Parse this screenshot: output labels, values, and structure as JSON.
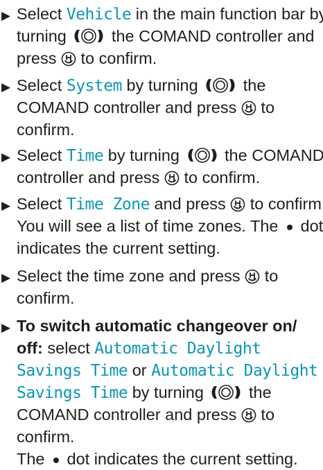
{
  "step1": {
    "l1_a": "Select ",
    "l1_term": "Vehicle",
    "l1_b": " in the main function bar by",
    "l2_a": "turning ",
    "l2_b": " the COMAND controller and",
    "l3_a": "press ",
    "l3_b": " to confirm."
  },
  "step2": {
    "l1_a": "Select ",
    "l1_term": "System",
    "l1_b": " by turning ",
    "l1_c": " the",
    "l2_a": "COMAND controller and press ",
    "l2_b": " to",
    "l3": "confirm."
  },
  "step3": {
    "l1_a": "Select ",
    "l1_term": "Time",
    "l1_b": " by turning ",
    "l1_c": " the COMAND",
    "l2_a": "controller and press ",
    "l2_b": " to confirm."
  },
  "step4": {
    "l1_a": "Select ",
    "l1_term": "Time Zone",
    "l1_b": " and press ",
    "l1_c": " to confirm.",
    "l2": "You will see a list of time zones. The",
    "l2_c": "dot",
    "l3": "indicates the current setting."
  },
  "step5": {
    "l1_a": "Select the time zone and press ",
    "l1_b": " to",
    "l2": "confirm."
  },
  "step6": {
    "l1_bold": "To switch automatic changeover on/",
    "l2_bold": "off:",
    "l2_a": " select ",
    "l2_term": "Automatic Daylight",
    "l3_term": "Savings Time",
    "l3_a": " or ",
    "l3_term2": "Automatic Daylight",
    "l4_term": "Savings Time",
    "l4_a": " by turning ",
    "l4_b": " the",
    "l5_a": "COMAND controller and press ",
    "l5_b": " to",
    "l6": "confirm.",
    "l7_a": "The",
    "l7_b": "dot indicates the current setting."
  },
  "icons": {
    "bullet": "black-right-triangle",
    "controller": "turn-controller-icon",
    "press": "press-confirm-icon",
    "dot": "selection-dot"
  },
  "colors": {
    "text": "#1e1e1e",
    "term": "#0a96b4"
  }
}
